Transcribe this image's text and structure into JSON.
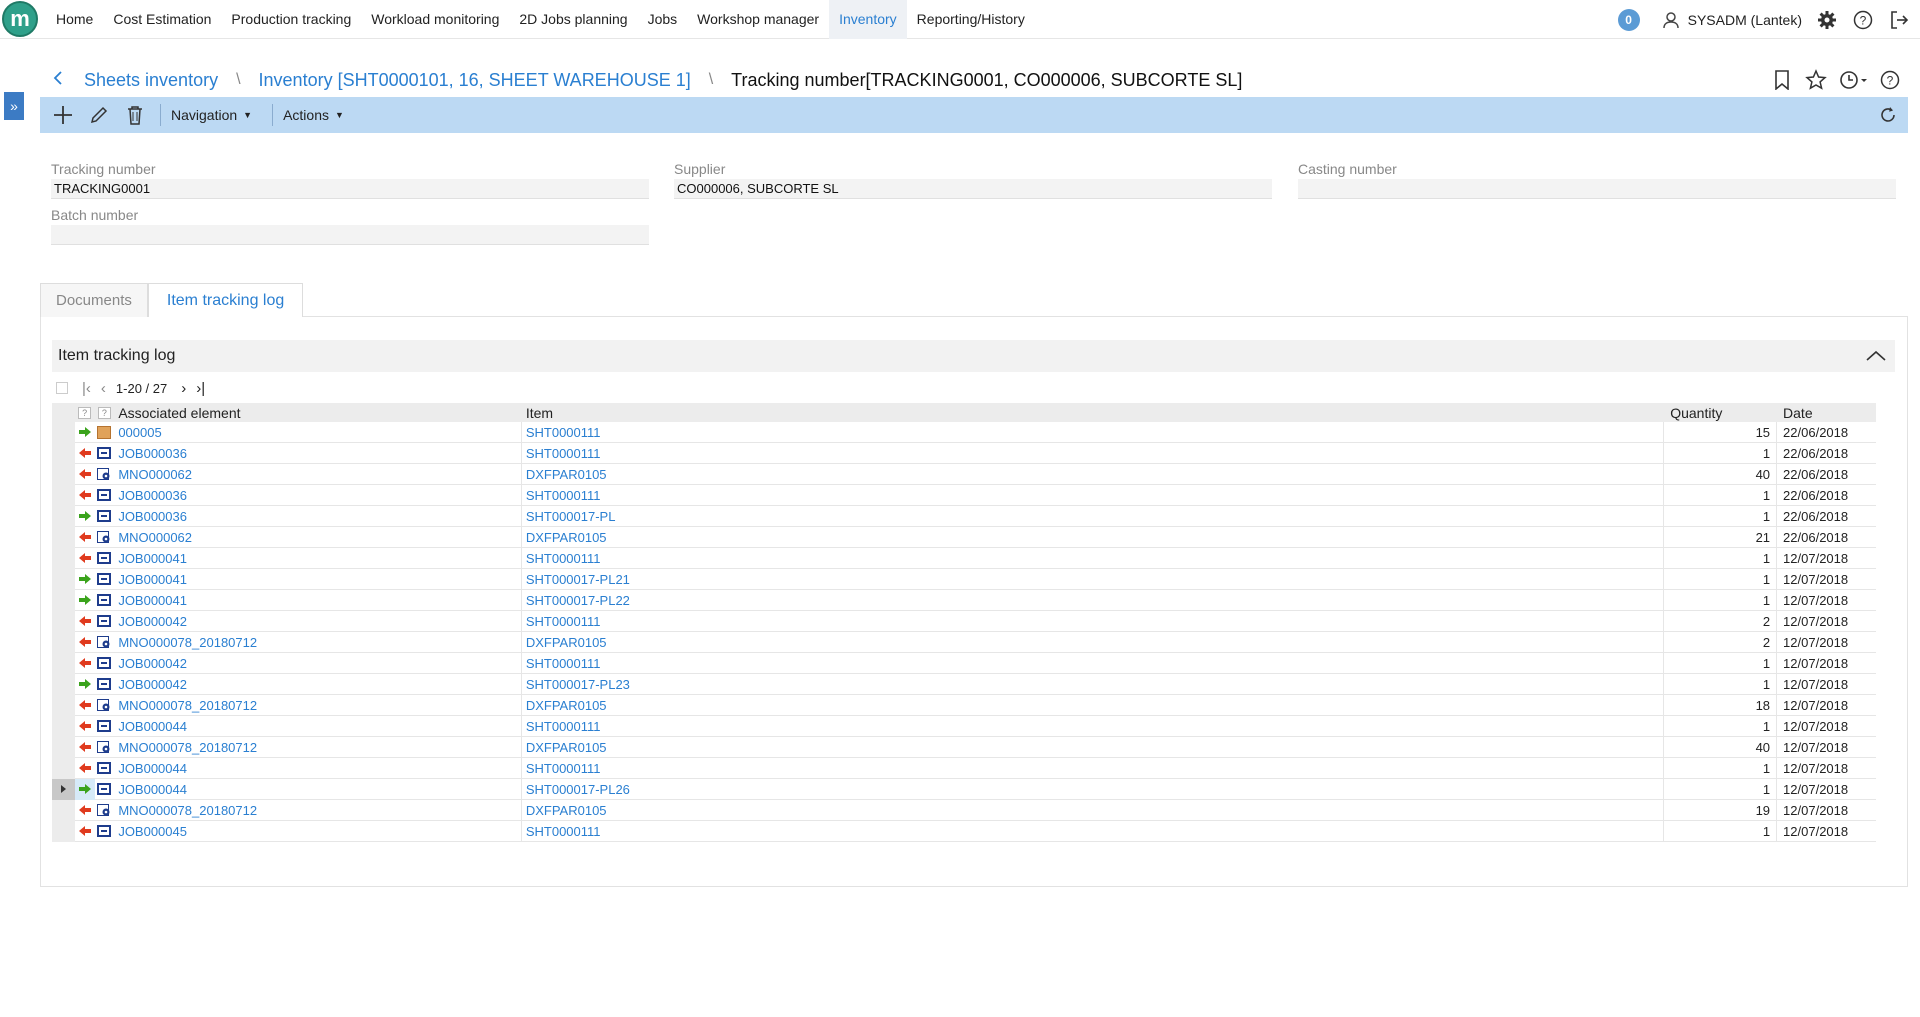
{
  "nav": {
    "logo": "m",
    "items": [
      "Home",
      "Cost Estimation",
      "Production tracking",
      "Workload monitoring",
      "2D Jobs planning",
      "Jobs",
      "Workshop manager",
      "Inventory",
      "Reporting/History"
    ],
    "active": "Inventory",
    "notifications": "0",
    "user": "SYSADM (Lantek)"
  },
  "breadcrumb": {
    "back_icon": "chevron-left-icon",
    "items": [
      "Sheets inventory",
      "Inventory [SHT0000101, 16, SHEET WAREHOUSE 1]"
    ],
    "current": "Tracking number[TRACKING0001, CO000006, SUBCORTE SL]"
  },
  "toolbar": {
    "navigation": "Navigation",
    "actions": "Actions"
  },
  "form": {
    "tracking_number": {
      "label": "Tracking number",
      "value": "TRACKING0001"
    },
    "supplier": {
      "label": "Supplier",
      "value": "CO000006, SUBCORTE SL"
    },
    "casting_number": {
      "label": "Casting number",
      "value": ""
    },
    "batch_number": {
      "label": "Batch number",
      "value": ""
    }
  },
  "tabs": [
    "Documents",
    "Item tracking log"
  ],
  "active_tab": "Item tracking log",
  "log": {
    "title": "Item tracking log",
    "pager": "1-20 / 27",
    "columns": {
      "icon1": "?",
      "icon2": "?",
      "assoc": "Associated element",
      "item": "Item",
      "qty": "Quantity",
      "date": "Date"
    },
    "rows": [
      {
        "dir": "in",
        "type": "box",
        "assoc": "000005",
        "item": "SHT0000111",
        "qty": "15",
        "date": "22/06/2018"
      },
      {
        "dir": "out",
        "type": "job",
        "assoc": "JOB000036",
        "item": "SHT0000111",
        "qty": "1",
        "date": "22/06/2018"
      },
      {
        "dir": "out",
        "type": "mno",
        "assoc": "MNO000062",
        "item": "DXFPAR0105",
        "qty": "40",
        "date": "22/06/2018"
      },
      {
        "dir": "out",
        "type": "job",
        "assoc": "JOB000036",
        "item": "SHT0000111",
        "qty": "1",
        "date": "22/06/2018"
      },
      {
        "dir": "in",
        "type": "job",
        "assoc": "JOB000036",
        "item": "SHT000017-PL",
        "qty": "1",
        "date": "22/06/2018"
      },
      {
        "dir": "out",
        "type": "mno",
        "assoc": "MNO000062",
        "item": "DXFPAR0105",
        "qty": "21",
        "date": "22/06/2018"
      },
      {
        "dir": "out",
        "type": "job",
        "assoc": "JOB000041",
        "item": "SHT0000111",
        "qty": "1",
        "date": "12/07/2018"
      },
      {
        "dir": "in",
        "type": "job",
        "assoc": "JOB000041",
        "item": "SHT000017-PL21",
        "qty": "1",
        "date": "12/07/2018"
      },
      {
        "dir": "in",
        "type": "job",
        "assoc": "JOB000041",
        "item": "SHT000017-PL22",
        "qty": "1",
        "date": "12/07/2018"
      },
      {
        "dir": "out",
        "type": "job",
        "assoc": "JOB000042",
        "item": "SHT0000111",
        "qty": "2",
        "date": "12/07/2018"
      },
      {
        "dir": "out",
        "type": "mno",
        "assoc": "MNO000078_20180712",
        "item": "DXFPAR0105",
        "qty": "2",
        "date": "12/07/2018"
      },
      {
        "dir": "out",
        "type": "job",
        "assoc": "JOB000042",
        "item": "SHT0000111",
        "qty": "1",
        "date": "12/07/2018"
      },
      {
        "dir": "in",
        "type": "job",
        "assoc": "JOB000042",
        "item": "SHT000017-PL23",
        "qty": "1",
        "date": "12/07/2018"
      },
      {
        "dir": "out",
        "type": "mno",
        "assoc": "MNO000078_20180712",
        "item": "DXFPAR0105",
        "qty": "18",
        "date": "12/07/2018"
      },
      {
        "dir": "out",
        "type": "job",
        "assoc": "JOB000044",
        "item": "SHT0000111",
        "qty": "1",
        "date": "12/07/2018"
      },
      {
        "dir": "out",
        "type": "mno",
        "assoc": "MNO000078_20180712",
        "item": "DXFPAR0105",
        "qty": "40",
        "date": "12/07/2018"
      },
      {
        "dir": "out",
        "type": "job",
        "assoc": "JOB000044",
        "item": "SHT0000111",
        "qty": "1",
        "date": "12/07/2018"
      },
      {
        "dir": "in",
        "type": "job",
        "assoc": "JOB000044",
        "item": "SHT000017-PL26",
        "qty": "1",
        "date": "12/07/2018",
        "current": true
      },
      {
        "dir": "out",
        "type": "mno",
        "assoc": "MNO000078_20180712",
        "item": "DXFPAR0105",
        "qty": "19",
        "date": "12/07/2018"
      },
      {
        "dir": "out",
        "type": "job",
        "assoc": "JOB000045",
        "item": "SHT0000111",
        "qty": "1",
        "date": "12/07/2018"
      }
    ]
  },
  "colors": {
    "accent": "#2a7fd1",
    "toolbar": "#bcd9f3",
    "in_arrow": "#3aa31c",
    "out_arrow": "#e03a1e"
  }
}
